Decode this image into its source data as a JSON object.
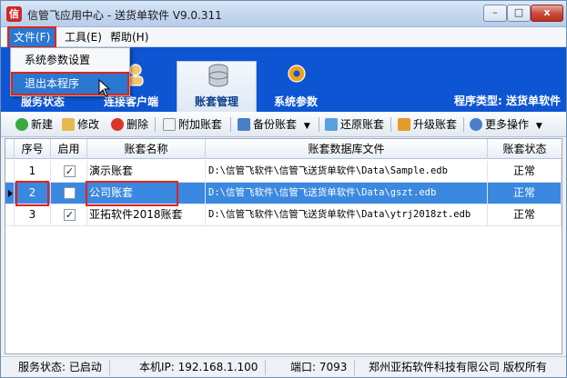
{
  "window": {
    "title": "信管飞应用中心 - 送货单软件 V9.0.311",
    "app_icon_text": "信",
    "controls": {
      "minimize": "–",
      "maximize": "□",
      "close": "x"
    }
  },
  "menubar": {
    "file": "文件(F)",
    "tools": "工具(E)",
    "help": "帮助(H)"
  },
  "file_menu": {
    "items": [
      "系统参数设置",
      "退出本程序"
    ],
    "highlighted": "退出本程序"
  },
  "nav": {
    "tabs": [
      "服务状态",
      "连接客户端",
      "账套管理",
      "系统参数"
    ],
    "active_tab": "账套管理",
    "program_type": "程序类型: 送货单软件"
  },
  "toolbar": {
    "new": "新建",
    "edit": "修改",
    "delete": "删除",
    "attach": "附加账套",
    "backup": "备份账套",
    "restore": "还原账套",
    "upgrade": "升级账套",
    "more": "更多操作"
  },
  "grid": {
    "columns": [
      "序号",
      "启用",
      "账套名称",
      "账套数据库文件",
      "账套状态"
    ],
    "rows": [
      {
        "no": "1",
        "enabled": "✓",
        "name": "演示账套",
        "file": "D:\\信管飞软件\\信管飞送货单软件\\Data\\Sample.edb",
        "status": "正常"
      },
      {
        "no": "2",
        "enabled": "",
        "name": "公司账套",
        "file": "D:\\信管飞软件\\信管飞送货单软件\\Data\\gszt.edb",
        "status": "正常"
      },
      {
        "no": "3",
        "enabled": "✓",
        "name": "亚拓软件2018账套",
        "file": "D:\\信管飞软件\\信管飞送货单软件\\Data\\ytrj2018zt.edb",
        "status": "正常"
      }
    ]
  },
  "statusbar": {
    "service": "服务状态: 已启动",
    "ip": "本机IP: 192.168.1.100",
    "port": "端口: 7093",
    "copyright": "郑州亚拓软件科技有限公司 版权所有"
  },
  "colors": {
    "banner": "#0d55d2",
    "selected_row": "#3a88e0",
    "highlight_box": "#e2231a"
  }
}
